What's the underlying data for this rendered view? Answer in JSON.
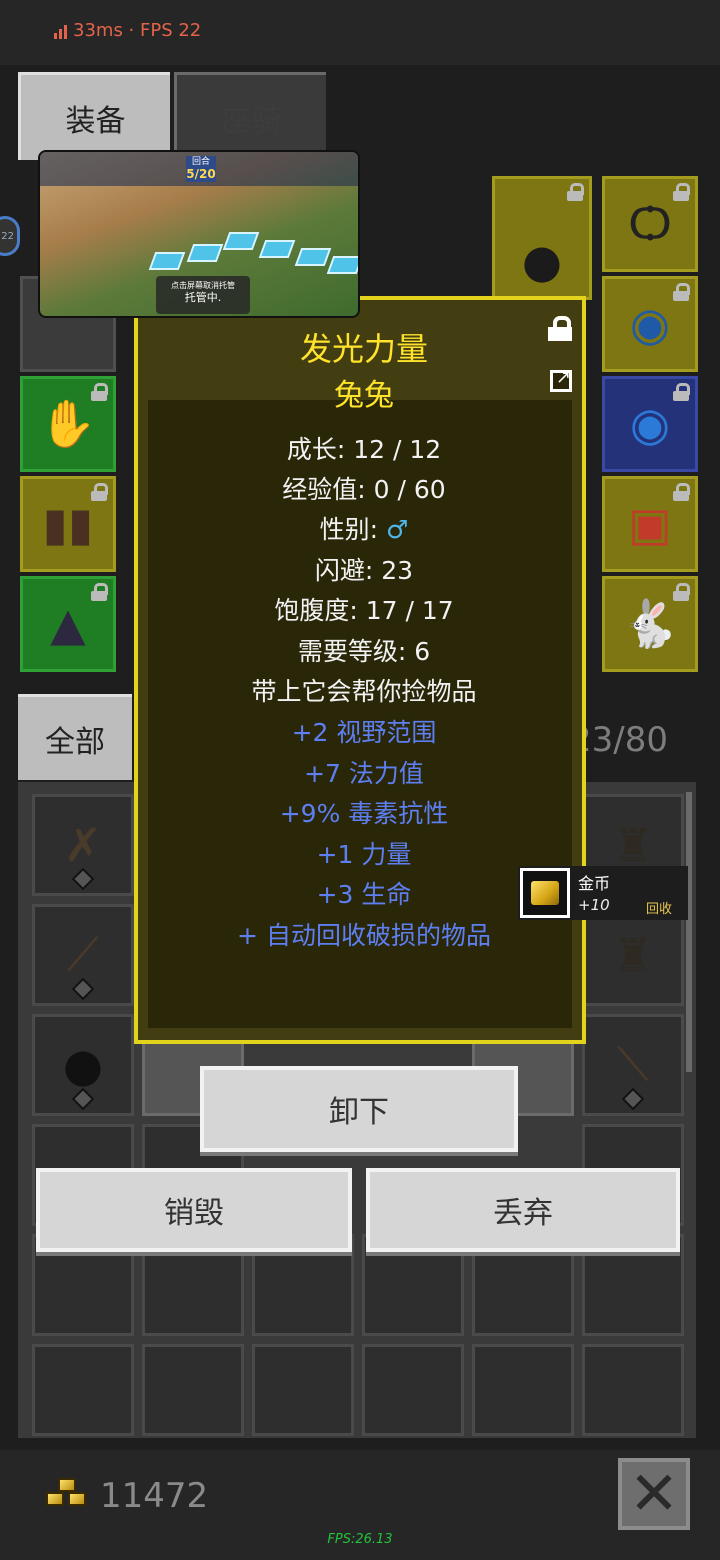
{
  "status": {
    "ping": "33ms · FPS 22"
  },
  "tabs": {
    "equip": "装备",
    "mount": "座骑"
  },
  "video": {
    "round_label": "回合",
    "round_value": "5/20",
    "hint_small": "点击屏幕取消托管",
    "hint_main": "托管中."
  },
  "side_badge": "22",
  "tooltip": {
    "title": "发光力量",
    "subtitle": "兔兔",
    "stats": [
      "成长: 12 / 12",
      "经验值: 0 / 60",
      "性别: ",
      "闪避: 23",
      "饱腹度: 17 / 17",
      "需要等级: 6",
      "带上它会帮你捡物品"
    ],
    "gender_symbol": "♂",
    "bonuses": [
      "+2 视野范围",
      "+7 法力值",
      "+9% 毒素抗性",
      "+1 力量",
      "+3 生命",
      "+ 自动回收破损的物品"
    ]
  },
  "gold_popup": {
    "name": "金币",
    "amount": "+10",
    "action": "回收"
  },
  "filter": {
    "all": "全部"
  },
  "inventory": {
    "count": "23/80"
  },
  "buttons": {
    "unequip": "卸下",
    "destroy": "销毁",
    "drop": "丢弃"
  },
  "footer": {
    "gold": "11472",
    "fps": "FPS:26.13",
    "close_symbol": "✕"
  },
  "colors": {
    "tooltip_border": "#e4d31c",
    "title_yellow": "#ffe32a",
    "bonus_blue": "#5d7ff2",
    "fps_green": "#23c23a",
    "status_red": "#e4634a"
  }
}
